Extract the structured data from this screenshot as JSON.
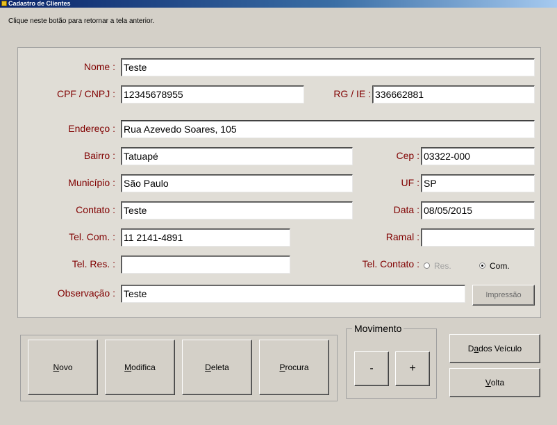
{
  "window": {
    "title": "Cadastro de Clientes"
  },
  "hint": "Clique neste botão para retornar a tela anterior.",
  "form": {
    "nome": {
      "label": "Nome :",
      "value": "Teste"
    },
    "cpf": {
      "label": "CPF / CNPJ :",
      "value": "12345678955"
    },
    "rg": {
      "label": "RG / IE :",
      "value": "336662881"
    },
    "endereco": {
      "label": "Endereço :",
      "value": "Rua Azevedo Soares, 105"
    },
    "bairro": {
      "label": "Bairro :",
      "value": "Tatuapé"
    },
    "cep": {
      "label": "Cep :",
      "value": "03322-000"
    },
    "municipio": {
      "label": "Município :",
      "value": "São Paulo"
    },
    "uf": {
      "label": "UF :",
      "value": "SP"
    },
    "contato": {
      "label": "Contato :",
      "value": "Teste"
    },
    "data": {
      "label": "Data :",
      "value": "08/05/2015"
    },
    "tel_com": {
      "label": "Tel. Com. :",
      "value": "11 2141-4891"
    },
    "ramal": {
      "label": "Ramal :",
      "value": ""
    },
    "tel_res": {
      "label": "Tel. Res. :",
      "value": ""
    },
    "tel_contato": {
      "label": "Tel. Contato :",
      "options": [
        "Res.",
        "Com."
      ],
      "selected": "Com."
    },
    "observacao": {
      "label": "Observação :",
      "value": "Teste"
    },
    "impressao_label": "Impressão"
  },
  "buttons": {
    "novo": {
      "mnemonic": "N",
      "rest": "ovo"
    },
    "modifica": {
      "mnemonic": "M",
      "rest": "odifica"
    },
    "deleta": {
      "mnemonic": "D",
      "rest": "eleta"
    },
    "procura": {
      "mnemonic": "P",
      "rest": "rocura"
    },
    "movimento_title": "Movimento",
    "minus": "-",
    "plus": "+",
    "dados_veiculo": {
      "pre": "D",
      "mnemonic": "a",
      "rest": "dos Veículo"
    },
    "volta": {
      "mnemonic": "V",
      "rest": "olta"
    }
  }
}
